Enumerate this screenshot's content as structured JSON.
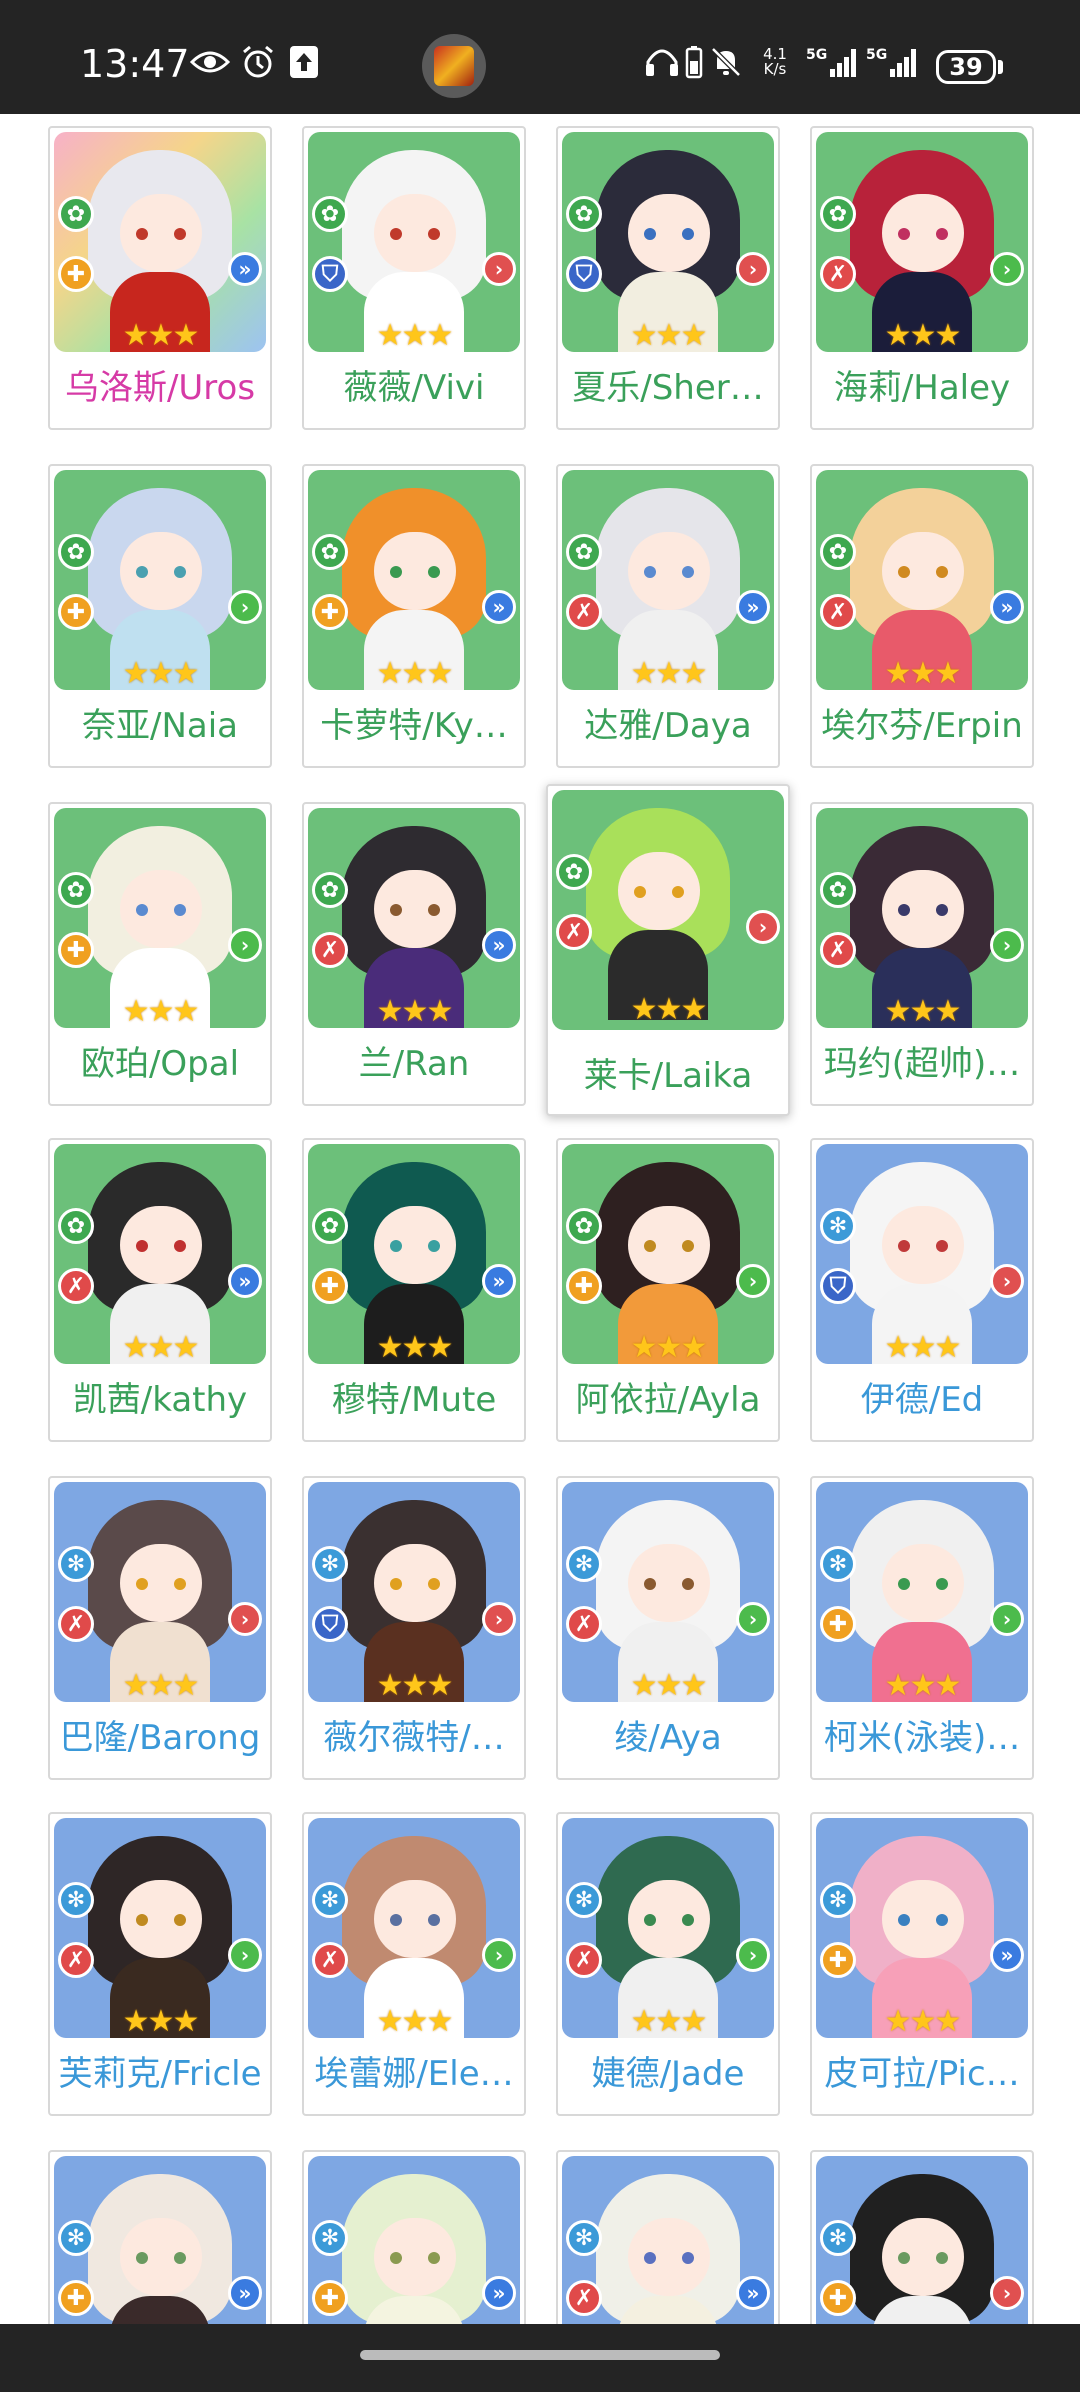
{
  "status_bar": {
    "time": "13:47",
    "network_speed": "4.1\nK/s",
    "battery": "39",
    "icons": [
      "eye-icon",
      "alarm-icon",
      "upload-icon",
      "headphones-icon",
      "battery-saver-icon",
      "mute-icon",
      "signal-5g-icon",
      "signal-5g-icon"
    ]
  },
  "colors": {
    "green_card": "#6cc07a",
    "blue_card": "#7ea7e3",
    "green_name": "#3aa05a",
    "blue_name": "#3a98d8",
    "pink_name": "#d63aa6",
    "star": "#ffc61a"
  },
  "characters": [
    {
      "name": "乌洛斯/Uros",
      "bg": "rainbow",
      "name_color": "pink",
      "element": "green",
      "role": "orange",
      "role_icon": "plus-icon",
      "arrow": "blue",
      "stars": "★★★"
    },
    {
      "name": "薇薇/Vivi",
      "bg": "green",
      "name_color": "green",
      "element": "green",
      "role": "blue",
      "role_icon": "shield-icon",
      "arrow": "red",
      "stars": "★★★"
    },
    {
      "name": "夏乐/Sher…",
      "bg": "green",
      "name_color": "green",
      "element": "green",
      "role": "blue",
      "role_icon": "shield-icon",
      "arrow": "red",
      "stars": "★★★"
    },
    {
      "name": "海莉/Haley",
      "bg": "green",
      "name_color": "green",
      "element": "green",
      "role": "red",
      "role_icon": "swords-icon",
      "arrow": "green",
      "stars": "★★★"
    },
    {
      "name": "奈亚/Naia",
      "bg": "green",
      "name_color": "green",
      "element": "green",
      "role": "orange",
      "role_icon": "plus-icon",
      "arrow": "green",
      "stars": "★★★"
    },
    {
      "name": "卡萝特/Ky…",
      "bg": "green",
      "name_color": "green",
      "element": "green",
      "role": "orange",
      "role_icon": "plus-icon",
      "arrow": "blue",
      "stars": "★★★"
    },
    {
      "name": "达雅/Daya",
      "bg": "green",
      "name_color": "green",
      "element": "green",
      "role": "red",
      "role_icon": "swords-icon",
      "arrow": "blue",
      "stars": "★★★"
    },
    {
      "name": "埃尔芬/Erpin",
      "bg": "green",
      "name_color": "green",
      "element": "green",
      "role": "red",
      "role_icon": "swords-icon",
      "arrow": "blue",
      "stars": "★★★"
    },
    {
      "name": "欧珀/Opal",
      "bg": "green",
      "name_color": "green",
      "element": "green",
      "role": "orange",
      "role_icon": "plus-icon",
      "arrow": "green",
      "stars": "★★★"
    },
    {
      "name": "兰/Ran",
      "bg": "green",
      "name_color": "green",
      "element": "green",
      "role": "red",
      "role_icon": "swords-icon",
      "arrow": "blue",
      "stars": "★★★"
    },
    {
      "name": "莱卡/Laika",
      "bg": "green",
      "name_color": "green",
      "element": "green",
      "role": "red",
      "role_icon": "swords-icon",
      "arrow": "red",
      "stars": "★★★",
      "selected": true
    },
    {
      "name": "玛约(超帅)…",
      "bg": "green",
      "name_color": "green",
      "element": "green",
      "role": "red",
      "role_icon": "swords-icon",
      "arrow": "green",
      "stars": "★★★"
    },
    {
      "name": "凯茜/kathy",
      "bg": "green",
      "name_color": "green",
      "element": "green",
      "role": "red",
      "role_icon": "swords-icon",
      "arrow": "blue",
      "stars": "★★★"
    },
    {
      "name": "穆特/Mute",
      "bg": "green",
      "name_color": "green",
      "element": "green",
      "role": "orange",
      "role_icon": "plus-icon",
      "arrow": "blue",
      "stars": "★★★"
    },
    {
      "name": "阿依拉/Ayla",
      "bg": "green",
      "name_color": "green",
      "element": "green",
      "role": "orange",
      "role_icon": "plus-icon",
      "arrow": "green",
      "stars": "★★★"
    },
    {
      "name": "伊德/Ed",
      "bg": "blue",
      "name_color": "blue",
      "element": "blue",
      "role": "blue",
      "role_icon": "shield-icon",
      "arrow": "red",
      "stars": "★★★"
    },
    {
      "name": "巴隆/Barong",
      "bg": "blue",
      "name_color": "blue",
      "element": "blue",
      "role": "red",
      "role_icon": "swords-icon",
      "arrow": "red",
      "stars": "★★★"
    },
    {
      "name": "薇尔薇特/…",
      "bg": "blue",
      "name_color": "blue",
      "element": "blue",
      "role": "blue",
      "role_icon": "shield-icon",
      "arrow": "red",
      "stars": "★★★"
    },
    {
      "name": "绫/Aya",
      "bg": "blue",
      "name_color": "blue",
      "element": "blue",
      "role": "red",
      "role_icon": "swords-icon",
      "arrow": "green",
      "stars": "★★★"
    },
    {
      "name": "柯米(泳装)…",
      "bg": "blue",
      "name_color": "blue",
      "element": "blue",
      "role": "orange",
      "role_icon": "plus-icon",
      "arrow": "green",
      "stars": "★★★"
    },
    {
      "name": "芙莉克/Fricle",
      "bg": "blue",
      "name_color": "blue",
      "element": "blue",
      "role": "red",
      "role_icon": "swords-icon",
      "arrow": "green",
      "stars": "★★★"
    },
    {
      "name": "埃蕾娜/Ele…",
      "bg": "blue",
      "name_color": "blue",
      "element": "blue",
      "role": "red",
      "role_icon": "swords-icon",
      "arrow": "green",
      "stars": "★★★"
    },
    {
      "name": "婕德/Jade",
      "bg": "blue",
      "name_color": "blue",
      "element": "blue",
      "role": "red",
      "role_icon": "swords-icon",
      "arrow": "green",
      "stars": "★★★"
    },
    {
      "name": "皮可拉/Pic…",
      "bg": "blue",
      "name_color": "blue",
      "element": "blue",
      "role": "orange",
      "role_icon": "plus-icon",
      "arrow": "blue",
      "stars": "★★★"
    },
    {
      "name": "",
      "bg": "blue",
      "name_color": "blue",
      "element": "blue",
      "role": "orange",
      "role_icon": "plus-icon",
      "arrow": "blue",
      "stars": ""
    },
    {
      "name": "",
      "bg": "blue",
      "name_color": "blue",
      "element": "blue",
      "role": "orange",
      "role_icon": "plus-icon",
      "arrow": "blue",
      "stars": ""
    },
    {
      "name": "",
      "bg": "blue",
      "name_color": "blue",
      "element": "blue",
      "role": "red",
      "role_icon": "swords-icon",
      "arrow": "blue",
      "stars": ""
    },
    {
      "name": "",
      "bg": "blue",
      "name_color": "blue",
      "element": "blue",
      "role": "orange",
      "role_icon": "plus-icon",
      "arrow": "red",
      "stars": ""
    }
  ]
}
